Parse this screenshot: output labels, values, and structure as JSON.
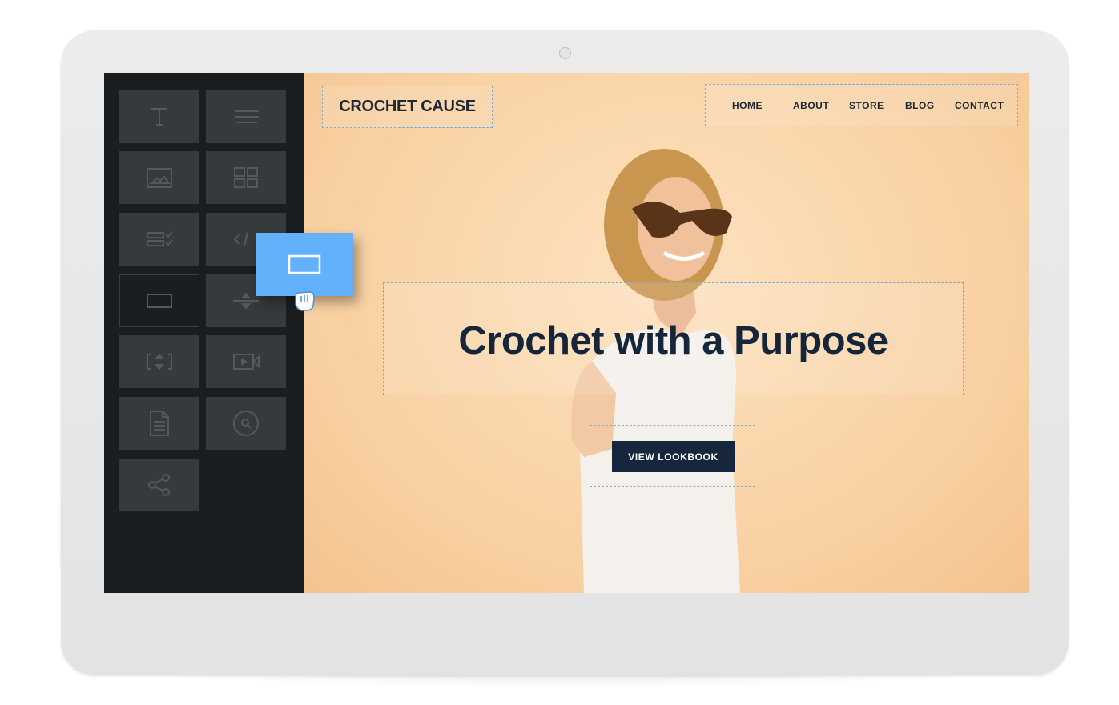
{
  "site": {
    "logo": "CROCHET CAUSE",
    "nav": [
      "HOME",
      "ABOUT",
      "STORE",
      "BLOG",
      "CONTACT"
    ],
    "headline": "Crochet with a Purpose",
    "cta": "VIEW LOOKBOOK"
  },
  "sidebar": {
    "tools": [
      {
        "icon": "text-icon"
      },
      {
        "icon": "paragraph-icon"
      },
      {
        "icon": "image-icon"
      },
      {
        "icon": "gallery-icon"
      },
      {
        "icon": "form-icon"
      },
      {
        "icon": "code-icon"
      },
      {
        "icon": "button-icon",
        "selected": true
      },
      {
        "icon": "divider-icon"
      },
      {
        "icon": "spacer-icon"
      },
      {
        "icon": "video-icon"
      },
      {
        "icon": "document-icon"
      },
      {
        "icon": "search-icon"
      },
      {
        "icon": "share-icon"
      }
    ]
  },
  "dragging": {
    "icon": "button-icon",
    "cursor": "grab-hand-icon"
  },
  "colors": {
    "accent": "#64b1fb",
    "sidebar": "#1a1e21",
    "tile": "#363a3d",
    "heading": "#16263a",
    "button": "#15263d",
    "hero": "#fbd9b0"
  }
}
